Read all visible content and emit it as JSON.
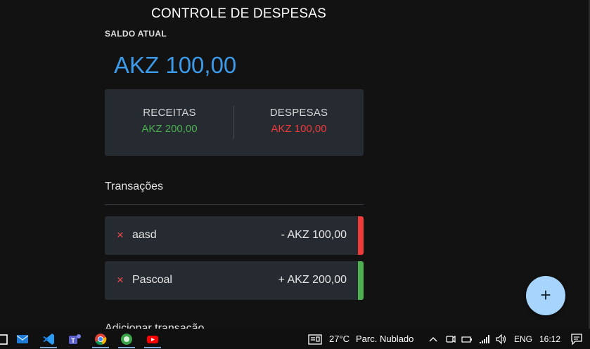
{
  "header": {
    "title": "CONTROLE DE DESPESAS"
  },
  "balance": {
    "label": "SALDO ATUAL",
    "value": "AKZ 100,00"
  },
  "summary": {
    "income_label": "RECEITAS",
    "income_value": "AKZ 200,00",
    "expense_label": "DESPESAS",
    "expense_value": "AKZ 100,00"
  },
  "transactions": {
    "title": "Transações",
    "items": [
      {
        "delete_icon": "×",
        "name": "aasd",
        "amount": "- AKZ 100,00",
        "type": "expense"
      },
      {
        "delete_icon": "×",
        "name": "Pascoal",
        "amount": "+ AKZ 200,00",
        "type": "income"
      }
    ]
  },
  "add_section": {
    "title": "Adicionar transação"
  },
  "fab": {
    "label": "+"
  },
  "taskbar": {
    "apps": [
      "file-explorer-icon",
      "mail-icon",
      "vscode-icon",
      "teams-icon",
      "chrome-icon",
      "app-icon",
      "youtube-icon"
    ],
    "weather": {
      "temp": "27°C",
      "condition": "Parc. Nublado"
    },
    "language": "ENG",
    "time": "16:12"
  },
  "colors": {
    "accent": "#3c9ae8",
    "income": "#4caf50",
    "expense": "#ef3b3b",
    "card": "#262a31",
    "fab": "#a6d4fa"
  }
}
